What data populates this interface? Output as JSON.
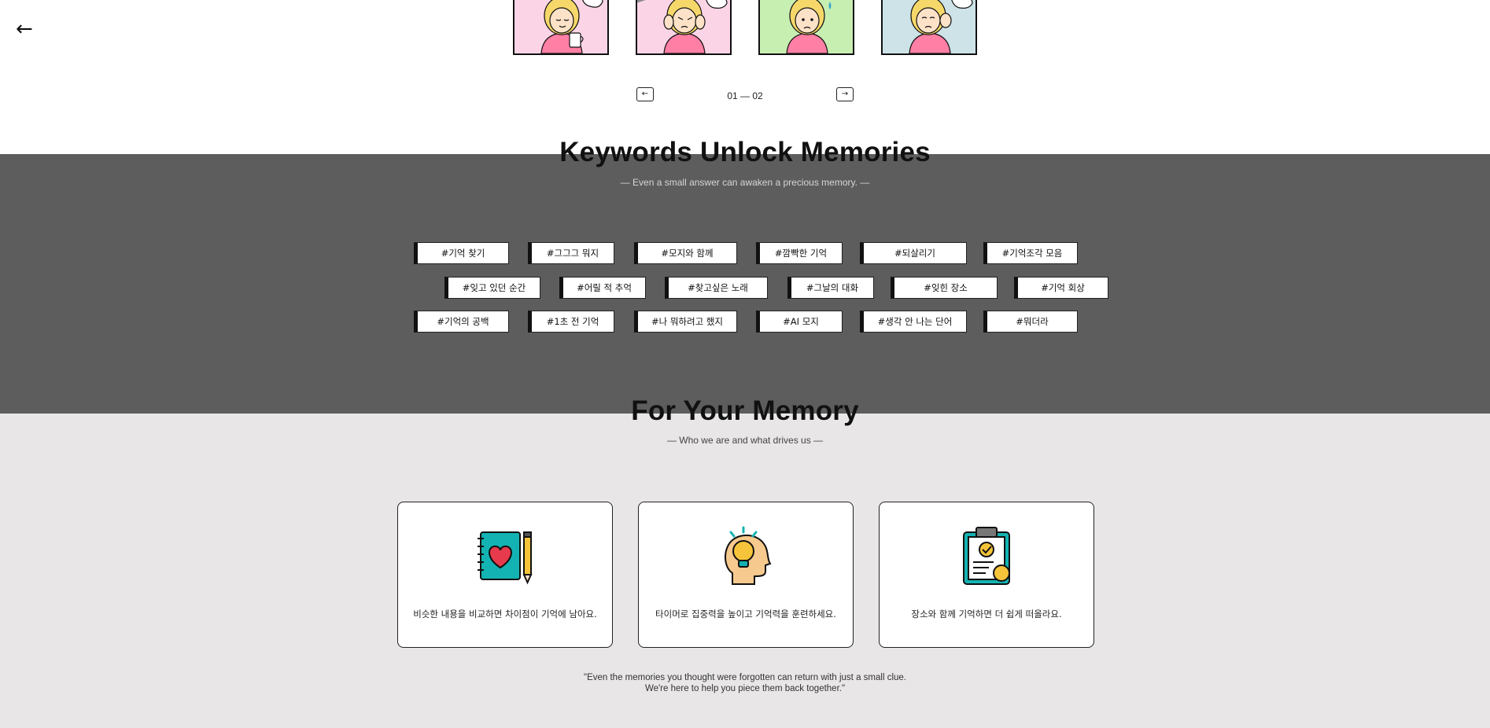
{
  "nav": {
    "back_label": "←"
  },
  "carousel": {
    "prev_label": "←",
    "next_label": "→",
    "page_text": "01 — 02",
    "panels": [
      {
        "bg": "#fbd5e6",
        "has_mug": true,
        "mood": "calm"
      },
      {
        "bg": "#fbd5e6",
        "has_mug": false,
        "mood": "stressed"
      },
      {
        "bg": "#c8efb2",
        "has_mug": false,
        "mood": "sad"
      },
      {
        "bg": "#cde3e8",
        "has_mug": false,
        "mood": "worried"
      }
    ]
  },
  "keywords": {
    "title": "Keywords Unlock Memories",
    "subtitle": "— Even a small answer can awaken a precious memory. —",
    "rows": [
      [
        "#기억 찾기",
        "#그그그 뭐지",
        "#모지와 함께",
        "#깜빡한 기억",
        "#되살리기",
        "#기억조각 모음"
      ],
      [
        "#잊고 있던 순간",
        "#어릴 적 추억",
        "#찾고싶은 노래",
        "#그날의 대화",
        "#잊힌 장소",
        "#기억 회상"
      ],
      [
        "#기억의 공백",
        "#1초 전 기억",
        "#나 뭐하려고 했지",
        "#AI 모지",
        "#생각 안 나는 단어",
        "#뭐더라"
      ]
    ]
  },
  "about": {
    "title": "For Your Memory",
    "subtitle": "— Who we are and what drives us —",
    "cards": [
      {
        "icon": "notebook-heart-icon",
        "text": "비슷한 내용을 비교하면 차이점이 기억에 남아요."
      },
      {
        "icon": "head-lightbulb-icon",
        "text": "타이머로 집중력을 높이고 기억력을 훈련하세요."
      },
      {
        "icon": "clipboard-check-icon",
        "text": "장소와 함께 기억하면 더 쉽게 떠올라요."
      }
    ],
    "quote_line1": "\"Even the memories you thought were forgotten can return with just a small clue.",
    "quote_line2": "We're here to help you piece them back together.\""
  },
  "colors": {
    "dark_band": "#5d5d5d",
    "light_band": "#e8e6e6",
    "teal": "#14b3b3",
    "heart": "#e83a4d",
    "yellow": "#f6c43a"
  }
}
